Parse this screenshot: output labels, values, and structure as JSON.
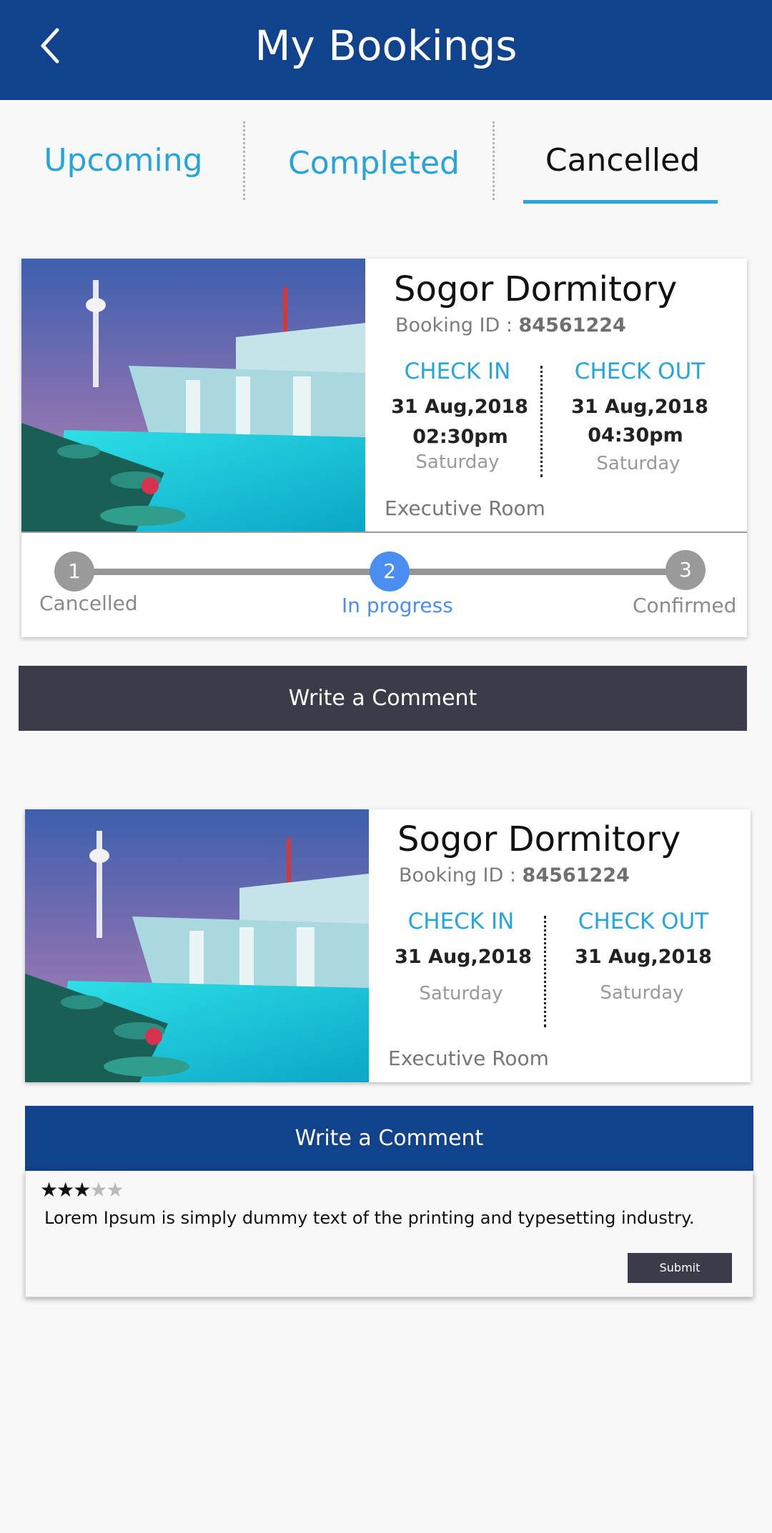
{
  "header": {
    "title": "My Bookings"
  },
  "tabs": [
    {
      "label": "Upcoming"
    },
    {
      "label": "Completed"
    },
    {
      "label": "Cancelled",
      "active": true
    }
  ],
  "bookings": [
    {
      "hotel_name": "Sogor Dormitory",
      "booking_id_label": "Booking ID : ",
      "booking_id": "84561224",
      "check_in_label": "CHECK IN",
      "check_in_date": "31 Aug,2018",
      "check_in_time": "02:30pm",
      "check_in_day": "Saturday",
      "check_out_label": "CHECK OUT",
      "check_out_date": "31 Aug,2018",
      "check_out_time": "04:30pm",
      "check_out_day": "Saturday",
      "room_type": "Executive Room",
      "progress_steps": [
        {
          "number": "1",
          "label": "Cancelled"
        },
        {
          "number": "2",
          "label": "In progress",
          "active": true
        },
        {
          "number": "3",
          "label": "Confirmed"
        }
      ],
      "comment_button": "Write a Comment"
    },
    {
      "hotel_name": "Sogor Dormitory",
      "booking_id_label": "Booking ID : ",
      "booking_id": "84561224",
      "check_in_label": "CHECK IN",
      "check_in_date": "31 Aug,2018",
      "check_in_day": "Saturday",
      "check_out_label": "CHECK OUT",
      "check_out_date": "31 Aug,2018",
      "check_out_day": "Saturday",
      "room_type": "Executive Room",
      "comment_button": "Write a Comment",
      "comment": {
        "rating": 3,
        "rating_max": 5,
        "text": "Lorem Ipsum is simply dummy text of the printing and typesetting industry.",
        "submit_label": "Submit"
      }
    }
  ],
  "colors": {
    "header_bg": "#11428c",
    "accent": "#26a5dc",
    "active_step": "#4a8ef2",
    "inactive_step": "#9a9a9a",
    "dark_button": "#3b3c4a"
  }
}
